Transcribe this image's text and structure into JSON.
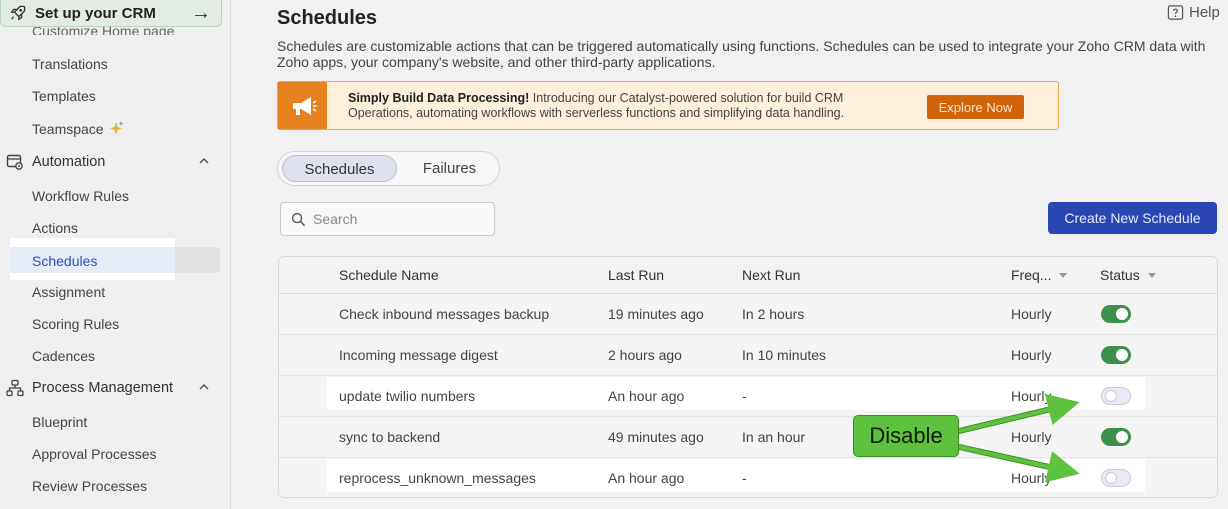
{
  "sidebar": {
    "setup_label": "Set up your CRM",
    "cut_item": "Customize Home page",
    "items_top": [
      "Translations",
      "Templates",
      "Teamspace"
    ],
    "automation_section": "Automation",
    "automation_items": [
      "Workflow Rules",
      "Actions",
      "Schedules",
      "Assignment",
      "Scoring Rules",
      "Cadences"
    ],
    "process_section": "Process Management",
    "process_items": [
      "Blueprint",
      "Approval Processes",
      "Review Processes"
    ]
  },
  "header": {
    "title": "Schedules",
    "help_label": "Help",
    "description": "Schedules are customizable actions that can be triggered automatically using functions. Schedules can be used to integrate your Zoho CRM data with Zoho apps, your company's website, and other third-party applications."
  },
  "banner": {
    "bold": "Simply Build Data Processing!",
    "text": " Introducing our Catalyst-powered solution for build CRM Operations, automating workflows with serverless functions and simplifying data handling.",
    "button": "Explore Now"
  },
  "tabs": [
    "Schedules",
    "Failures"
  ],
  "search": {
    "placeholder": "Search"
  },
  "create_button": "Create New Schedule",
  "table": {
    "columns": [
      "Schedule Name",
      "Last Run",
      "Next Run",
      "Freq...",
      "Status"
    ],
    "rows": [
      {
        "name": "Check inbound messages backup",
        "last_run": "19 minutes ago",
        "next_run": "In 2 hours",
        "frequency": "Hourly",
        "status": "on"
      },
      {
        "name": "Incoming message digest",
        "last_run": "2 hours ago",
        "next_run": "In 10 minutes",
        "frequency": "Hourly",
        "status": "on"
      },
      {
        "name": "update twilio numbers",
        "last_run": "An hour ago",
        "next_run": "-",
        "frequency": "Hourly",
        "status": "off"
      },
      {
        "name": "sync to backend",
        "last_run": "49 minutes ago",
        "next_run": "In an hour",
        "frequency": "Hourly",
        "status": "on"
      },
      {
        "name": "reprocess_unknown_messages",
        "last_run": "An hour ago",
        "next_run": "-",
        "frequency": "Hourly",
        "status": "off"
      }
    ]
  },
  "annotation": {
    "label": "Disable",
    "color": "#5fc23f"
  },
  "colors": {
    "accent": "#2946b3",
    "toggle_on": "#3d8f4d",
    "banner_orange": "#e5821f"
  }
}
